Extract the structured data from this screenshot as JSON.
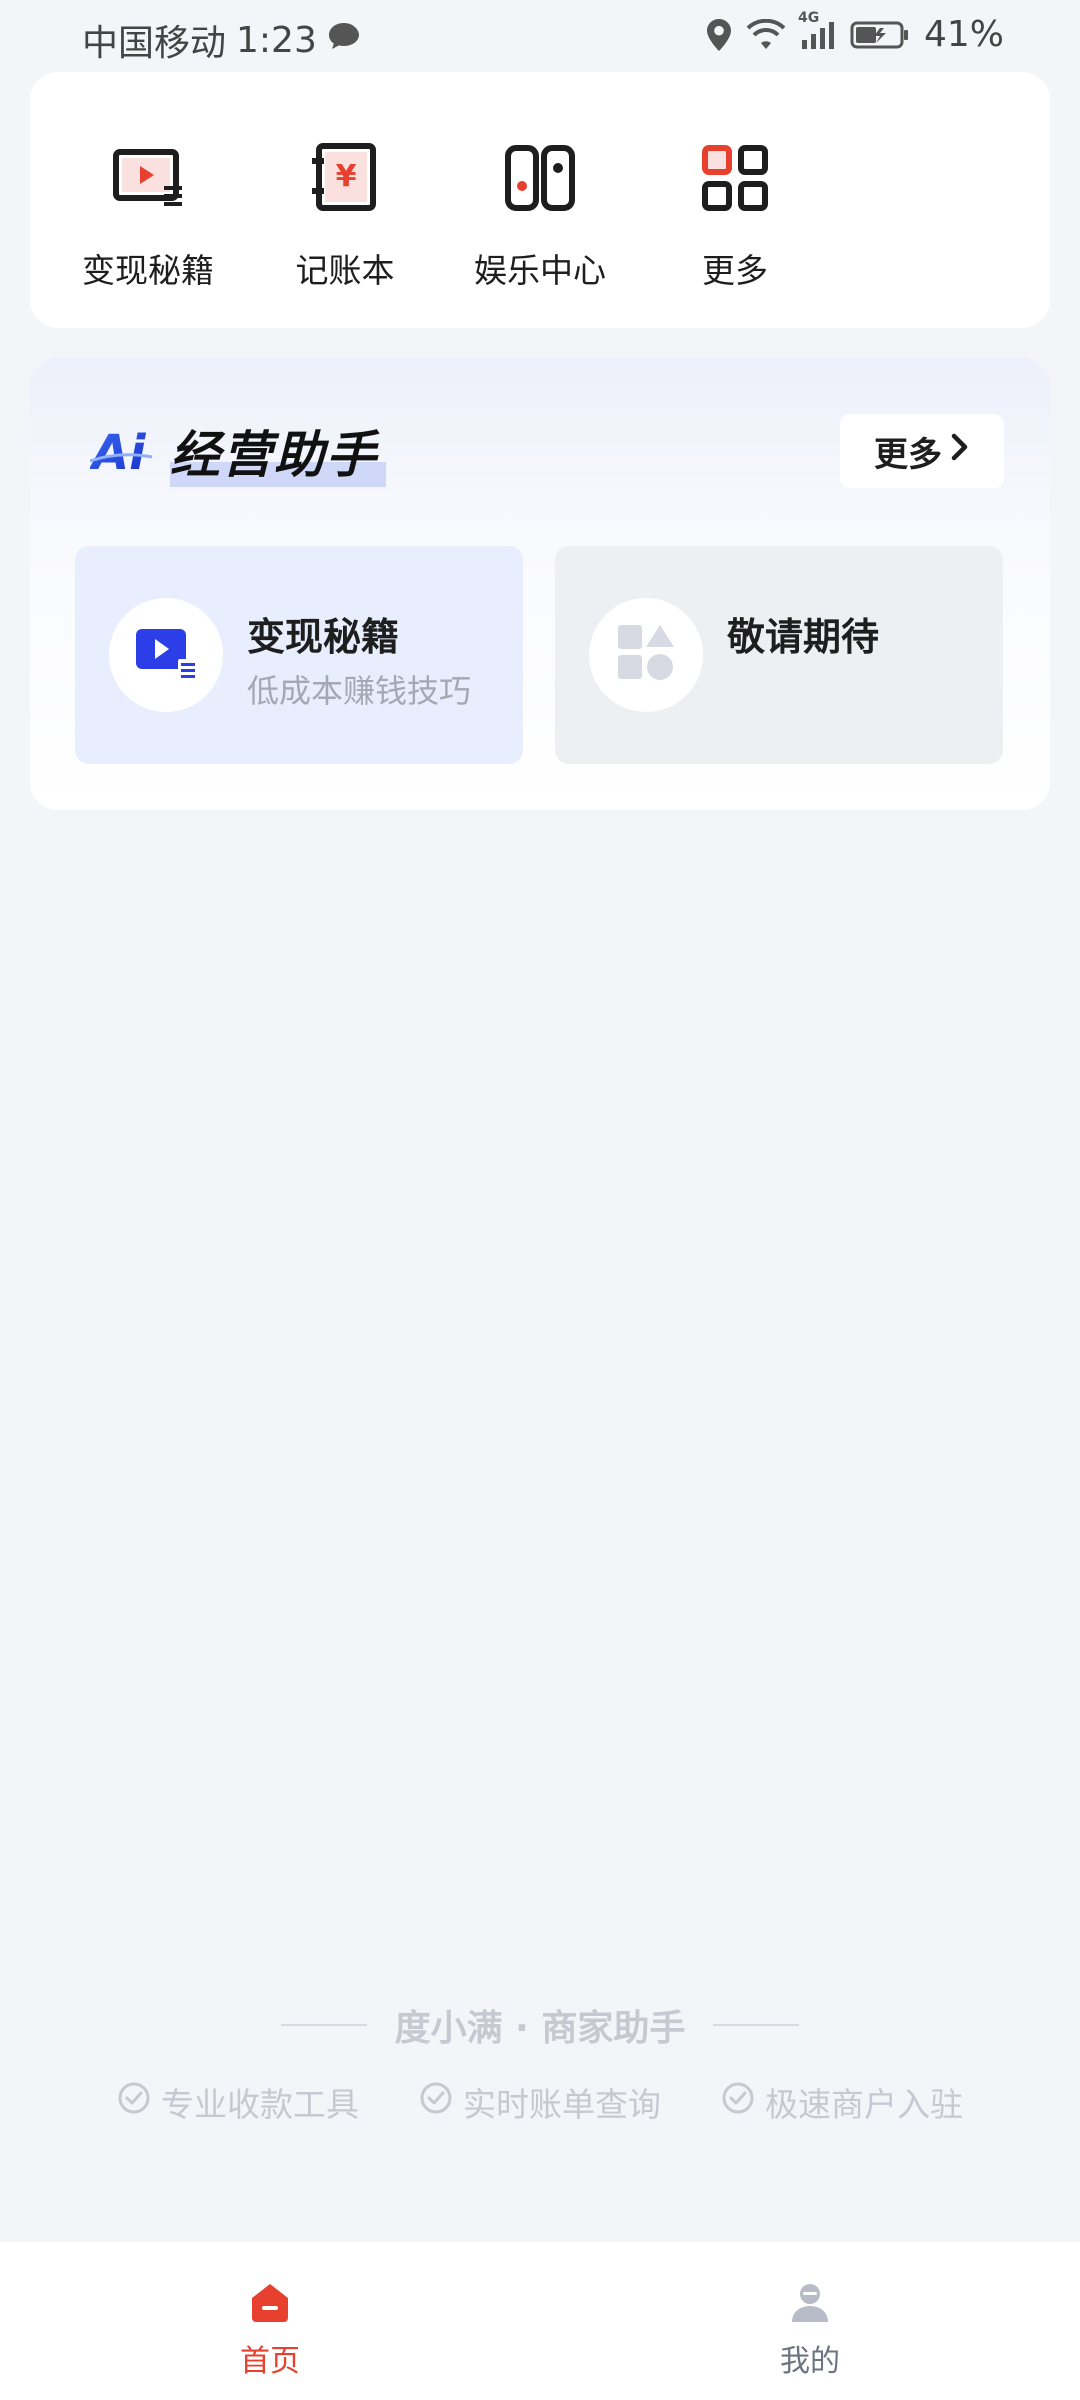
{
  "status_bar": {
    "carrier": "中国移动",
    "time": "1:23",
    "network": "4G",
    "battery": "41%"
  },
  "quick_actions": [
    {
      "label": "变现秘籍",
      "icon": "video-list-icon"
    },
    {
      "label": "记账本",
      "icon": "ledger-book-icon"
    },
    {
      "label": "娱乐中心",
      "icon": "game-console-icon"
    },
    {
      "label": "更多",
      "icon": "grid-apps-icon"
    }
  ],
  "ai_section": {
    "logo_text": "Ai",
    "title": "经营助手",
    "more_label": "更多",
    "tiles": [
      {
        "title": "变现秘籍",
        "subtitle": "低成本赚钱技巧",
        "icon": "video-list-icon"
      },
      {
        "title": "敬请期待",
        "subtitle": "",
        "icon": "shapes-icon"
      }
    ]
  },
  "footer": {
    "brand": "度小满 · 商家助手",
    "features": [
      "专业收款工具",
      "实时账单查询",
      "极速商户入驻"
    ]
  },
  "bottom_nav": [
    {
      "label": "首页",
      "active": true,
      "icon": "home-icon"
    },
    {
      "label": "我的",
      "active": false,
      "icon": "user-icon"
    }
  ],
  "colors": {
    "accent_red": "#e8402f",
    "accent_blue": "#2b3ee8",
    "inactive_gray": "#9aa0ad",
    "background": "#f4f5f9"
  }
}
